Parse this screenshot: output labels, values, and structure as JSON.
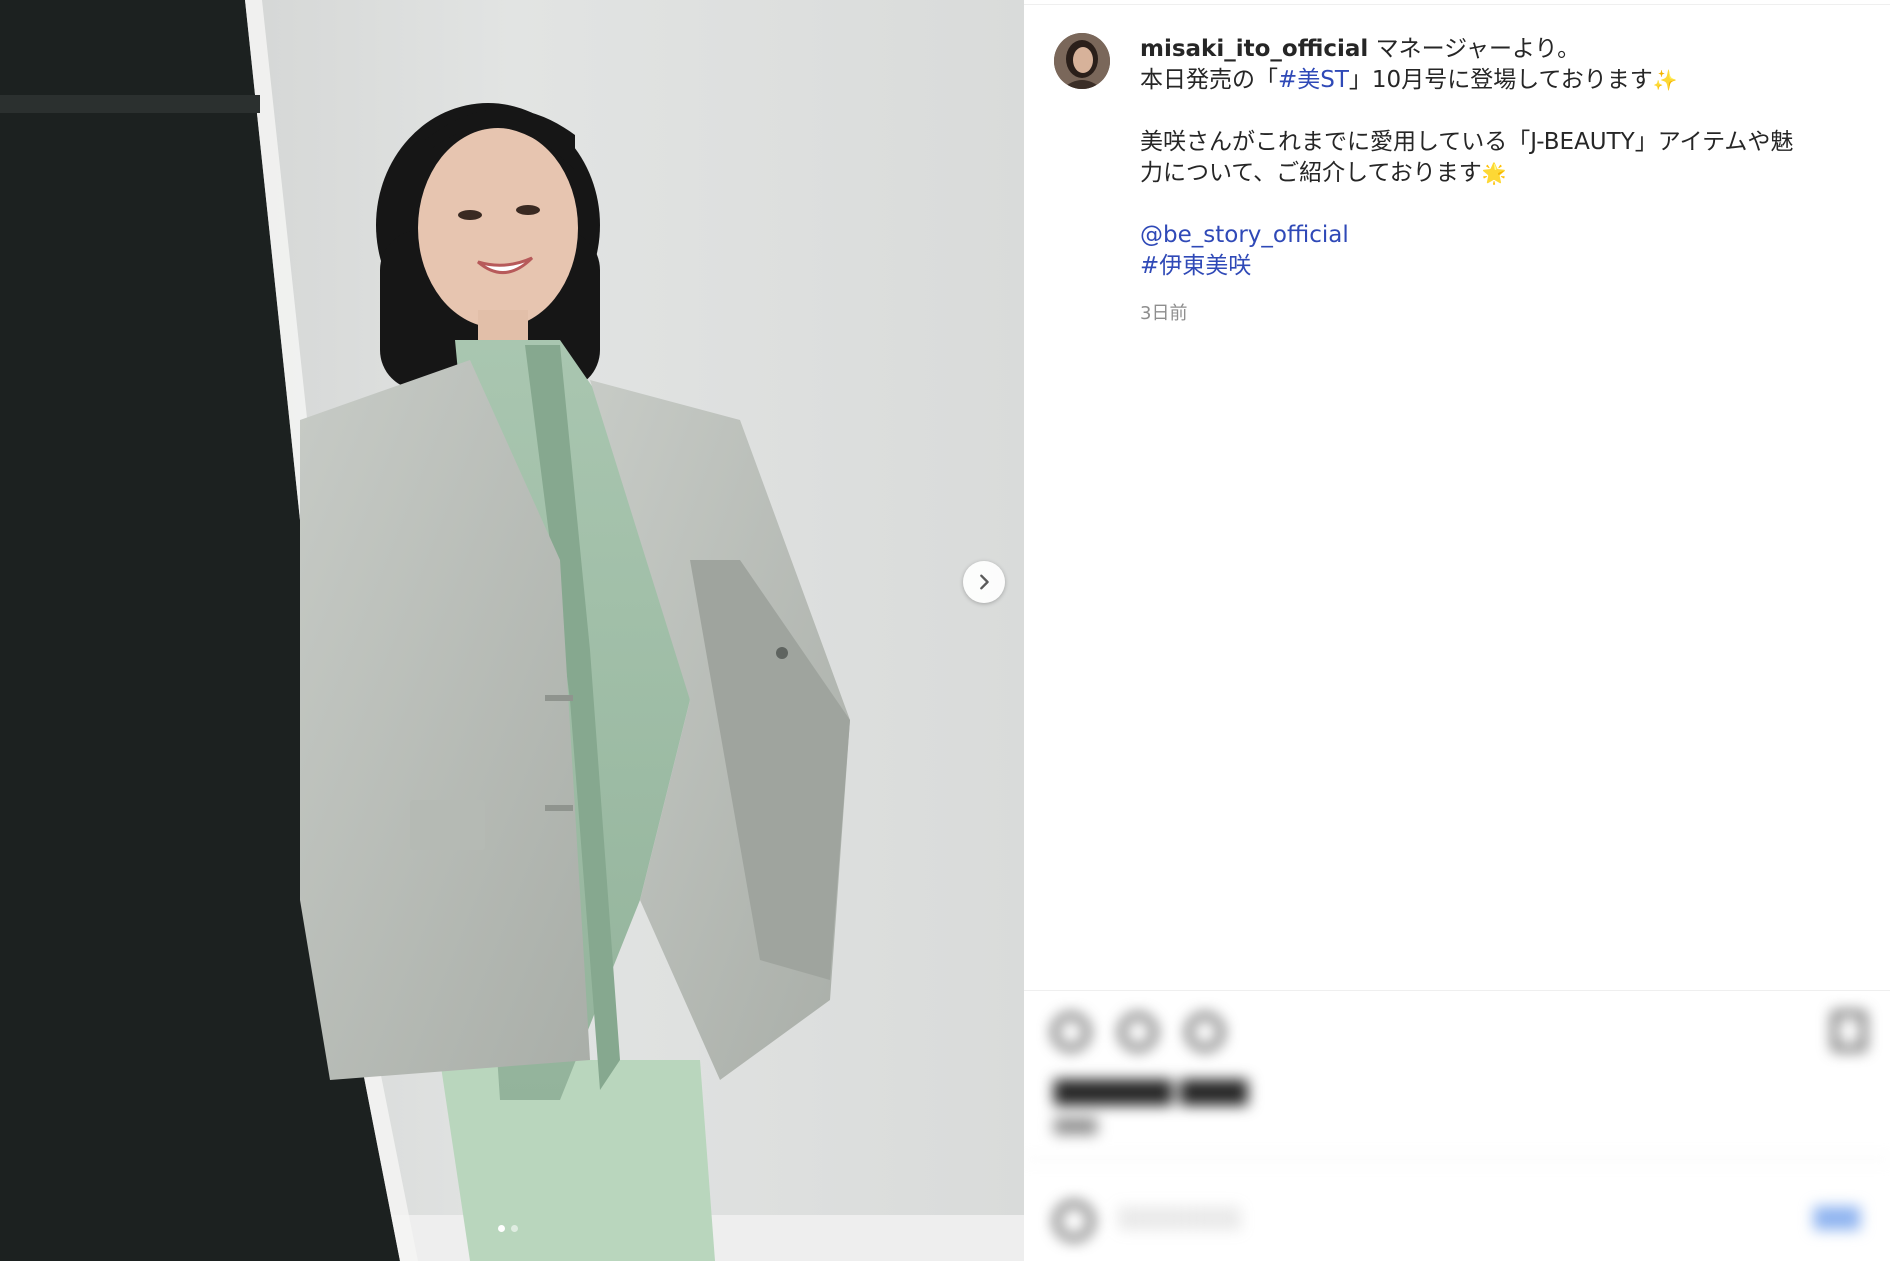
{
  "post": {
    "username": "misaki_ito_official",
    "caption": {
      "line1_after_username": " マネージャーより。",
      "line2_before": "本日発売の「",
      "line2_hashtag": "#美ST",
      "line2_after": "」10月号に登場しております",
      "line2_emoji": "✨",
      "line3": "美咲さんがこれまでに愛用している「J-BEAUTY」アイテムや魅",
      "line4": "力について、ご紹介しております",
      "line4_emoji": "🌟",
      "mention": "@be_story_official",
      "hashtag_name": "#伊東美咲"
    },
    "timestamp": "3日前"
  },
  "media": {
    "carousel_total": 2,
    "carousel_current": 1,
    "next_icon": "chevron-right-icon"
  },
  "footer": {
    "blurred": true,
    "icons": [
      "heart-icon",
      "comment-icon",
      "share-icon",
      "bookmark-icon",
      "emoji-icon"
    ],
    "colors": {
      "link": "#2f49b7",
      "post_button": "#8fb4f0",
      "muted": "#8e8e8e"
    }
  }
}
